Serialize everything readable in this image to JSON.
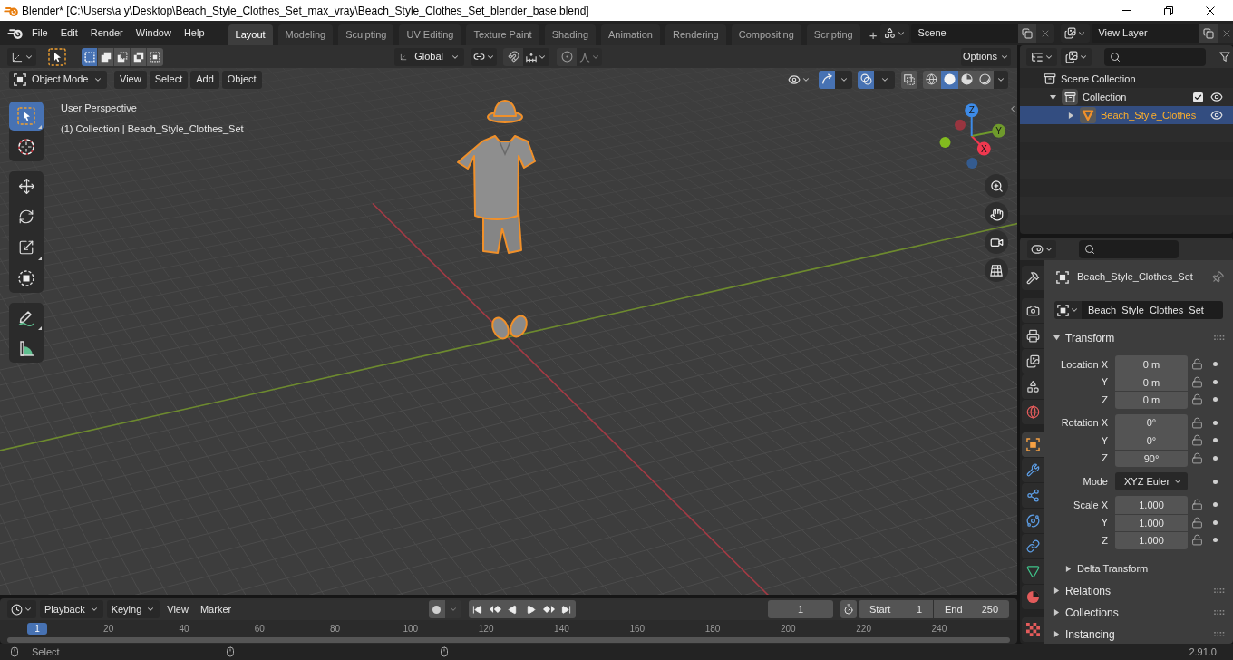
{
  "window": {
    "title": "Blender* [C:\\Users\\a y\\Desktop\\Beach_Style_Clothes_Set_max_vray\\Beach_Style_Clothes_Set_blender_base.blend]"
  },
  "menu": [
    "File",
    "Edit",
    "Render",
    "Window",
    "Help"
  ],
  "workspaces": [
    {
      "label": "Layout",
      "selected": true
    },
    {
      "label": "Modeling",
      "selected": false
    },
    {
      "label": "Sculpting",
      "selected": false
    },
    {
      "label": "UV Editing",
      "selected": false
    },
    {
      "label": "Texture Paint",
      "selected": false
    },
    {
      "label": "Shading",
      "selected": false
    },
    {
      "label": "Animation",
      "selected": false
    },
    {
      "label": "Rendering",
      "selected": false
    },
    {
      "label": "Compositing",
      "selected": false
    },
    {
      "label": "Scripting",
      "selected": false
    }
  ],
  "add_workspace": "+",
  "scene": "Scene",
  "view_layer": "View Layer",
  "tool_settings": {
    "select_modes": [
      {
        "kind": "new",
        "selected": true
      },
      {
        "kind": "extend",
        "selected": false
      },
      {
        "kind": "subtract",
        "selected": false
      },
      {
        "kind": "invert",
        "selected": false
      },
      {
        "kind": "intersect",
        "selected": false
      }
    ],
    "orientation": "Global",
    "snap": false,
    "proportional": false,
    "options": "Options"
  },
  "viewport_header": {
    "mode": "Object Mode",
    "menus": [
      "View",
      "Select",
      "Add",
      "Object"
    ],
    "gizmos": true,
    "overlays": true,
    "xray": false,
    "shading": [
      {
        "kind": "wireframe",
        "selected": false
      },
      {
        "kind": "solid",
        "selected": true
      },
      {
        "kind": "material",
        "selected": false
      },
      {
        "kind": "rendered",
        "selected": false
      }
    ]
  },
  "toolbar": [
    {
      "tools": [
        {
          "kind": "select_box",
          "selected": true,
          "variants": true
        },
        {
          "kind": "cursor",
          "selected": false,
          "variants": false
        }
      ]
    },
    {
      "tools": [
        {
          "kind": "move",
          "selected": false,
          "variants": false
        },
        {
          "kind": "rotate",
          "selected": false,
          "variants": false
        },
        {
          "kind": "scale",
          "selected": false,
          "variants": true
        },
        {
          "kind": "transform",
          "selected": false,
          "variants": false
        }
      ]
    },
    {
      "tools": [
        {
          "kind": "annotate",
          "selected": false,
          "variants": true
        },
        {
          "kind": "measure",
          "selected": false,
          "variants": false
        }
      ]
    }
  ],
  "viewport": {
    "view_name": "User Perspective",
    "info": "(1) Collection | Beach_Style_Clothes_Set",
    "axes": [
      {
        "label": "X",
        "color": "#f0384f"
      },
      {
        "label": "Y",
        "color": "#6f9a2c"
      },
      {
        "label": "Z",
        "color": "#3d8be8"
      }
    ]
  },
  "outliner": {
    "tree": [
      {
        "label": "Scene Collection",
        "kind": "scene_collection",
        "selected": false,
        "children": [
          {
            "label": "Collection",
            "kind": "collection",
            "selected": false,
            "expanded": true,
            "checked": true,
            "visible": true,
            "children": [
              {
                "label": "Beach_Style_Clothes",
                "kind": "mesh_object",
                "selected": true,
                "expanded": false,
                "visible": true
              }
            ]
          }
        ]
      }
    ]
  },
  "properties": {
    "tab_groups": [
      {
        "tabs": [
          {
            "kind": "tool",
            "selected": false
          }
        ]
      },
      {
        "tabs": [
          {
            "kind": "render",
            "selected": false
          },
          {
            "kind": "output",
            "selected": false
          },
          {
            "kind": "view_layer",
            "selected": false
          },
          {
            "kind": "scene",
            "selected": false
          },
          {
            "kind": "world",
            "selected": false
          }
        ]
      },
      {
        "tabs": [
          {
            "kind": "object",
            "selected": true
          },
          {
            "kind": "modifier",
            "selected": false
          },
          {
            "kind": "particles",
            "selected": false
          },
          {
            "kind": "physics",
            "selected": false
          },
          {
            "kind": "constraints",
            "selected": false
          },
          {
            "kind": "data",
            "selected": false
          },
          {
            "kind": "material",
            "selected": false
          }
        ]
      },
      {
        "tabs": [
          {
            "kind": "texture",
            "selected": false
          }
        ]
      }
    ],
    "context": "Beach_Style_Clothes_Set",
    "object_name": "Beach_Style_Clothes_Set",
    "transform": {
      "title": "Transform",
      "expanded": true,
      "groups": [
        {
          "kind": "number",
          "rows": [
            {
              "label": "Location X",
              "value": "0 m",
              "locked": false
            },
            {
              "label": "Y",
              "value": "0 m",
              "locked": false
            },
            {
              "label": "Z",
              "value": "0 m",
              "locked": false
            }
          ]
        },
        {
          "kind": "number",
          "rows": [
            {
              "label": "Rotation X",
              "value": "0°",
              "locked": false
            },
            {
              "label": "Y",
              "value": "0°",
              "locked": false
            },
            {
              "label": "Z",
              "value": "90°",
              "locked": false
            }
          ]
        },
        {
          "kind": "dropdown",
          "rows": [
            {
              "label": "Mode",
              "value": "XYZ Euler"
            }
          ]
        },
        {
          "kind": "number",
          "rows": [
            {
              "label": "Scale X",
              "value": "1.000",
              "locked": false
            },
            {
              "label": "Y",
              "value": "1.000",
              "locked": false
            },
            {
              "label": "Z",
              "value": "1.000",
              "locked": false
            }
          ]
        }
      ],
      "subpanels": [
        {
          "title": "Delta Transform",
          "expanded": false
        }
      ]
    },
    "panels": [
      {
        "title": "Relations",
        "expanded": false
      },
      {
        "title": "Collections",
        "expanded": false
      },
      {
        "title": "Instancing",
        "expanded": false
      }
    ]
  },
  "timeline": {
    "menus": [
      {
        "label": "Playback",
        "kind": "dropdown"
      },
      {
        "label": "Keying",
        "kind": "dropdown"
      },
      {
        "label": "View",
        "kind": "menu"
      },
      {
        "label": "Marker",
        "kind": "menu"
      }
    ],
    "auto_keying": false,
    "current_frame": "1",
    "start": {
      "label": "Start",
      "value": "1"
    },
    "end": {
      "label": "End",
      "value": "250"
    },
    "ruler": {
      "playhead": "1",
      "ticks": [
        "20",
        "40",
        "60",
        "80",
        "100",
        "120",
        "140",
        "160",
        "180",
        "200",
        "220",
        "240"
      ]
    }
  },
  "status_bar": {
    "hint": "Select",
    "version": "2.91.0"
  }
}
